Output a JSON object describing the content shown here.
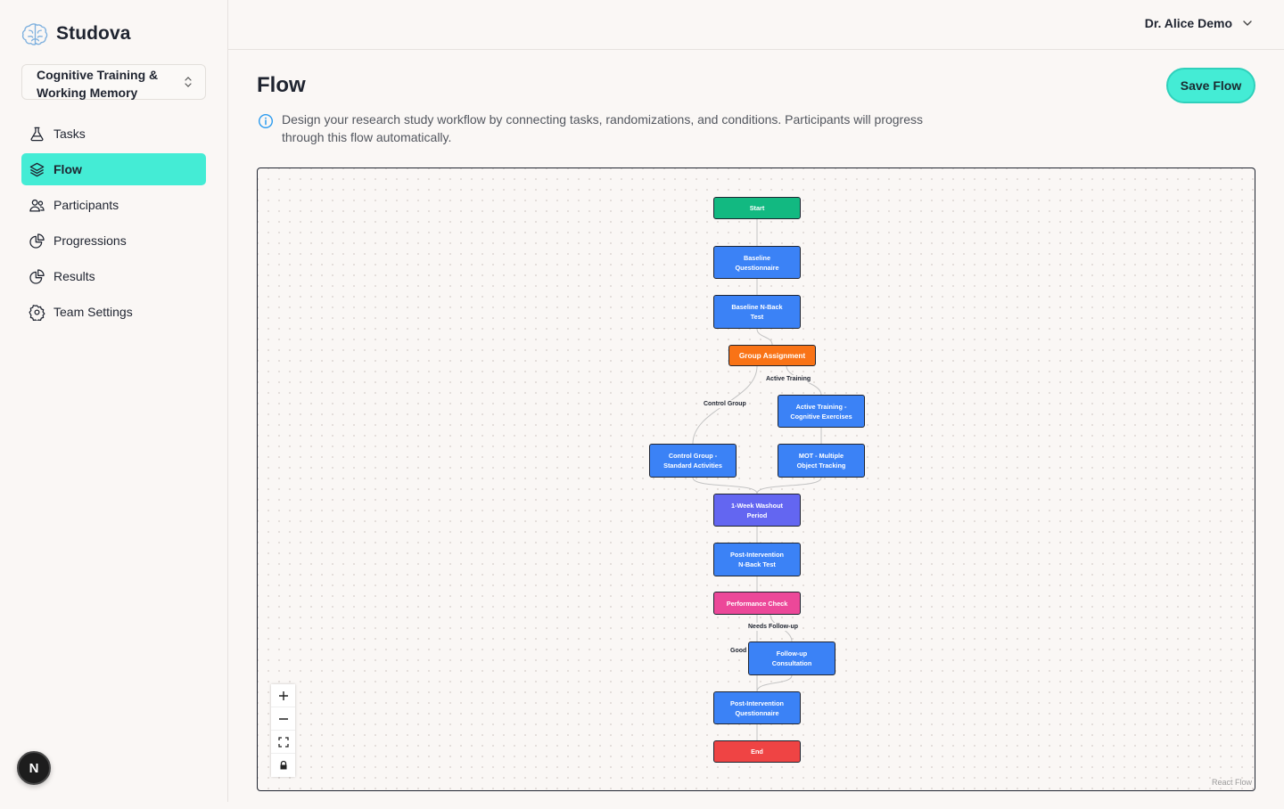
{
  "app": {
    "name": "Studova",
    "logo_icon": "brain-icon"
  },
  "study_selector": {
    "value": "Cognitive Training & Working Memory"
  },
  "nav": {
    "items": [
      {
        "label": "Tasks",
        "icon": "flask-icon",
        "active": false
      },
      {
        "label": "Flow",
        "icon": "layers-icon",
        "active": true
      },
      {
        "label": "Participants",
        "icon": "users-icon",
        "active": false
      },
      {
        "label": "Progressions",
        "icon": "pie-chart-icon",
        "active": false
      },
      {
        "label": "Results",
        "icon": "pie-chart-icon",
        "active": false
      },
      {
        "label": "Team Settings",
        "icon": "gear-icon",
        "active": false
      }
    ]
  },
  "user": {
    "name": "Dr. Alice Demo"
  },
  "badge": {
    "letter": "N"
  },
  "page": {
    "title": "Flow",
    "save_label": "Save Flow",
    "info": "Design your research study workflow by connecting tasks, randomizations, and conditions. Participants will progress through this flow automatically."
  },
  "flow": {
    "nodes": {
      "start": "Start",
      "baseline_questionnaire": "Baseline\nQuestionnaire",
      "baseline_nback": "Baseline N-Back\nTest",
      "group_assignment": "Group Assignment",
      "active_training": "Active Training -\nCognitive Exercises",
      "control_group": "Control Group -\nStandard Activities",
      "mot": "MOT - Multiple\nObject Tracking",
      "washout": "1-Week Washout\nPeriod",
      "post_nback": "Post-Intervention\nN-Back Test",
      "performance_check": "Performance Check",
      "follow_up": "Follow-up\nConsultation",
      "post_questionnaire": "Post-Intervention\nQuestionnaire",
      "end": "End"
    },
    "edge_labels": {
      "active_training": "Active Training",
      "control_group": "Control Group",
      "needs_follow_up": "Needs Follow-up",
      "good": "Good"
    }
  },
  "attribution": "React Flow",
  "colors": {
    "accent": "#44ecd5",
    "start": "#12b981",
    "task": "#3b82f6",
    "randomization": "#f97316",
    "delay": "#6366f1",
    "condition": "#ec4899",
    "end": "#ef4444"
  }
}
